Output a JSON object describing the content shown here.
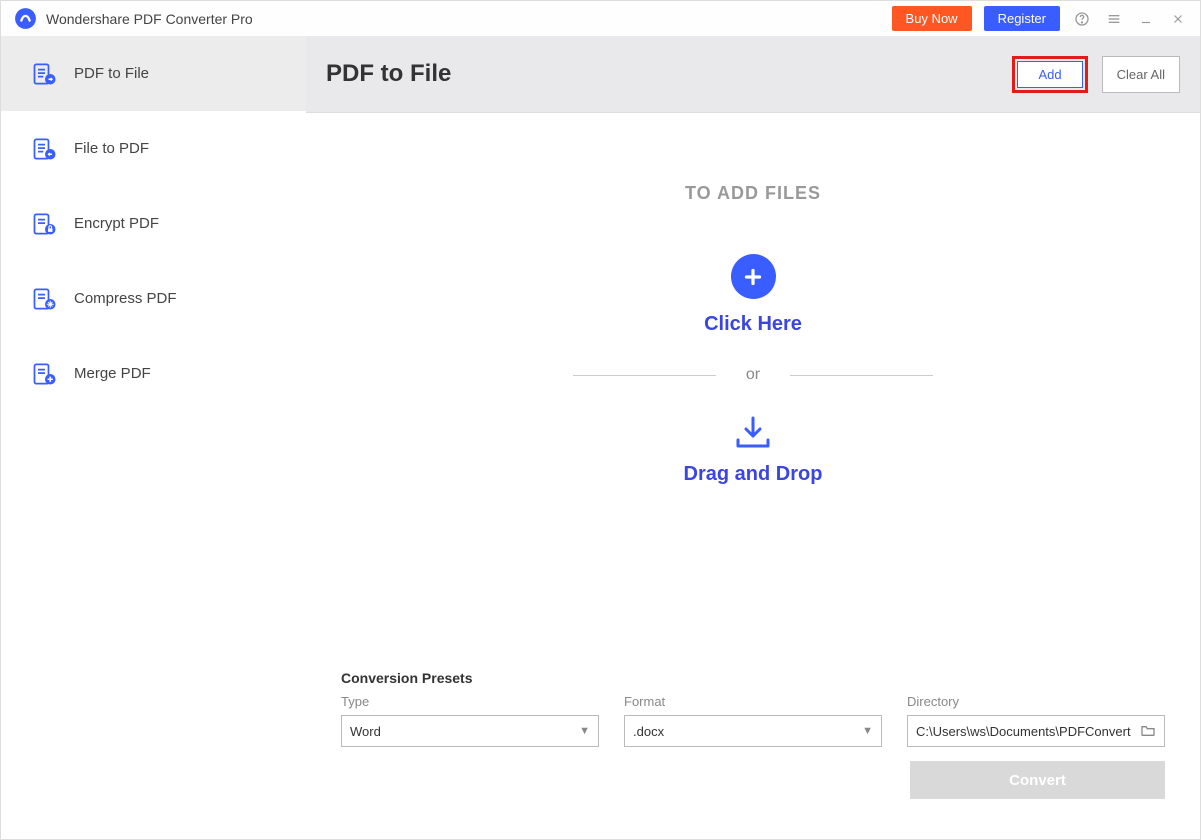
{
  "titlebar": {
    "app_name": "Wondershare PDF Converter Pro",
    "buy_now": "Buy Now",
    "register": "Register"
  },
  "sidebar": {
    "items": [
      {
        "label": "PDF to File"
      },
      {
        "label": "File to PDF"
      },
      {
        "label": "Encrypt PDF"
      },
      {
        "label": "Compress PDF"
      },
      {
        "label": "Merge PDF"
      }
    ]
  },
  "header": {
    "title": "PDF to File",
    "add": "Add",
    "clear_all": "Clear All"
  },
  "drop": {
    "to_add_files": "TO ADD FILES",
    "click_here": "Click Here",
    "or": "or",
    "drag_and_drop": "Drag and Drop"
  },
  "presets": {
    "title": "Conversion Presets",
    "type_label": "Type",
    "type_value": "Word",
    "format_label": "Format",
    "format_value": ".docx",
    "directory_label": "Directory",
    "directory_value": "C:\\Users\\ws\\Documents\\PDFConvert",
    "convert": "Convert"
  }
}
